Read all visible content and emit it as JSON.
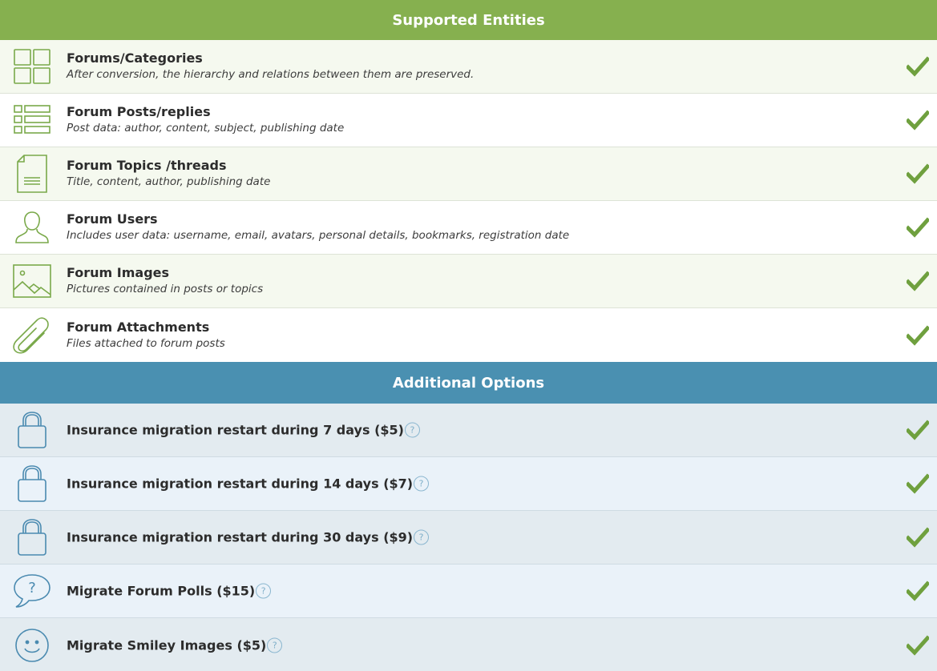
{
  "supported": {
    "title": "Supported Entities",
    "items": [
      {
        "icon": "grid-icon",
        "title": "Forums/Categories",
        "desc": "After conversion, the hierarchy and relations between them are preserved."
      },
      {
        "icon": "list-icon",
        "title": "Forum Posts/replies",
        "desc": "Post data: author, content, subject, publishing date"
      },
      {
        "icon": "document-icon",
        "title": "Forum Topics /threads",
        "desc": "Title, content, author, publishing date"
      },
      {
        "icon": "user-icon",
        "title": "Forum Users",
        "desc": "Includes user data: username, email, avatars, personal details, bookmarks, registration date"
      },
      {
        "icon": "image-icon",
        "title": "Forum Images",
        "desc": "Pictures contained in posts or topics"
      },
      {
        "icon": "paperclip-icon",
        "title": "Forum Attachments",
        "desc": "Files attached to forum posts"
      }
    ]
  },
  "additional": {
    "title": "Additional Options",
    "help_label": "?",
    "items": [
      {
        "icon": "lock-icon",
        "title": "Insurance migration restart during 7 days ($5)"
      },
      {
        "icon": "lock-icon",
        "title": "Insurance migration restart during 14 days ($7)"
      },
      {
        "icon": "lock-icon",
        "title": "Insurance migration restart during 30 days ($9)"
      },
      {
        "icon": "speech-bubble-question-icon",
        "title": "Migrate Forum Polls ($15)"
      },
      {
        "icon": "smiley-icon",
        "title": "Migrate Smiley Images ($5)"
      }
    ]
  },
  "colors": {
    "green_header": "#86b04f",
    "blue_header": "#4a90b1",
    "green_icon": "#7aa94a",
    "blue_icon": "#4a8ab0",
    "check": "#6fa03e"
  }
}
